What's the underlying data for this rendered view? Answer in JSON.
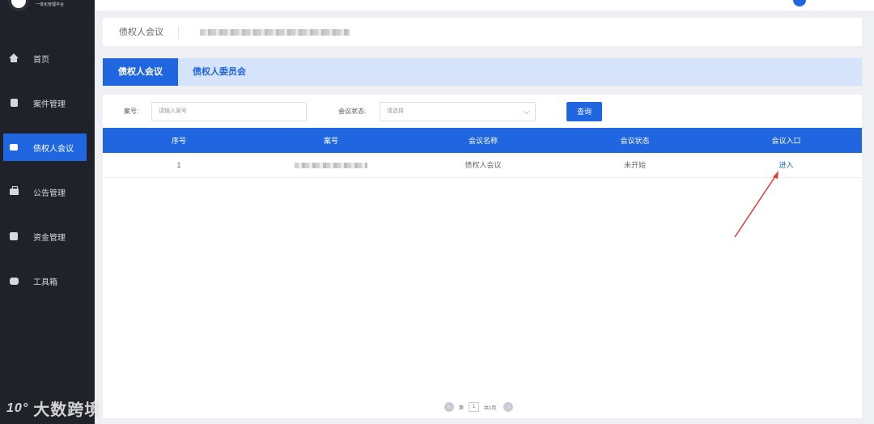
{
  "logo": {
    "subtitle": "一体化管理平台"
  },
  "sidebar": {
    "items": [
      {
        "label": "首页",
        "icon": "home-icon"
      },
      {
        "label": "案件管理",
        "icon": "case-icon"
      },
      {
        "label": "债权人会议",
        "icon": "video-icon",
        "active": true
      },
      {
        "label": "公告管理",
        "icon": "briefcase-icon"
      },
      {
        "label": "资金管理",
        "icon": "money-icon"
      },
      {
        "label": "工具箱",
        "icon": "toolbox-icon"
      }
    ]
  },
  "breadcrumb": {
    "title": "债权人会议"
  },
  "tabs": [
    {
      "label": "债权人会议",
      "active": true
    },
    {
      "label": "债权人委员会",
      "active": false
    }
  ],
  "filters": {
    "case_label": "案号:",
    "case_placeholder": "请输入案号",
    "status_label": "会议状态:",
    "status_placeholder": "请选择",
    "query_button": "查询"
  },
  "table": {
    "columns": [
      "序号",
      "案号",
      "会议名称",
      "会议状态",
      "会议入口"
    ],
    "rows": [
      {
        "index": "1",
        "meeting_name": "债权人会议",
        "status": "未开始",
        "entry": "进入"
      }
    ]
  },
  "pagination": {
    "prefix": "第",
    "current": "1",
    "suffix": "共1页"
  },
  "watermark": {
    "text": "大数跨境"
  },
  "colors": {
    "primary": "#1f66e0",
    "sidebar": "#1f2329",
    "tab_bg": "#d6e4fb",
    "arrow": "#e53935"
  }
}
